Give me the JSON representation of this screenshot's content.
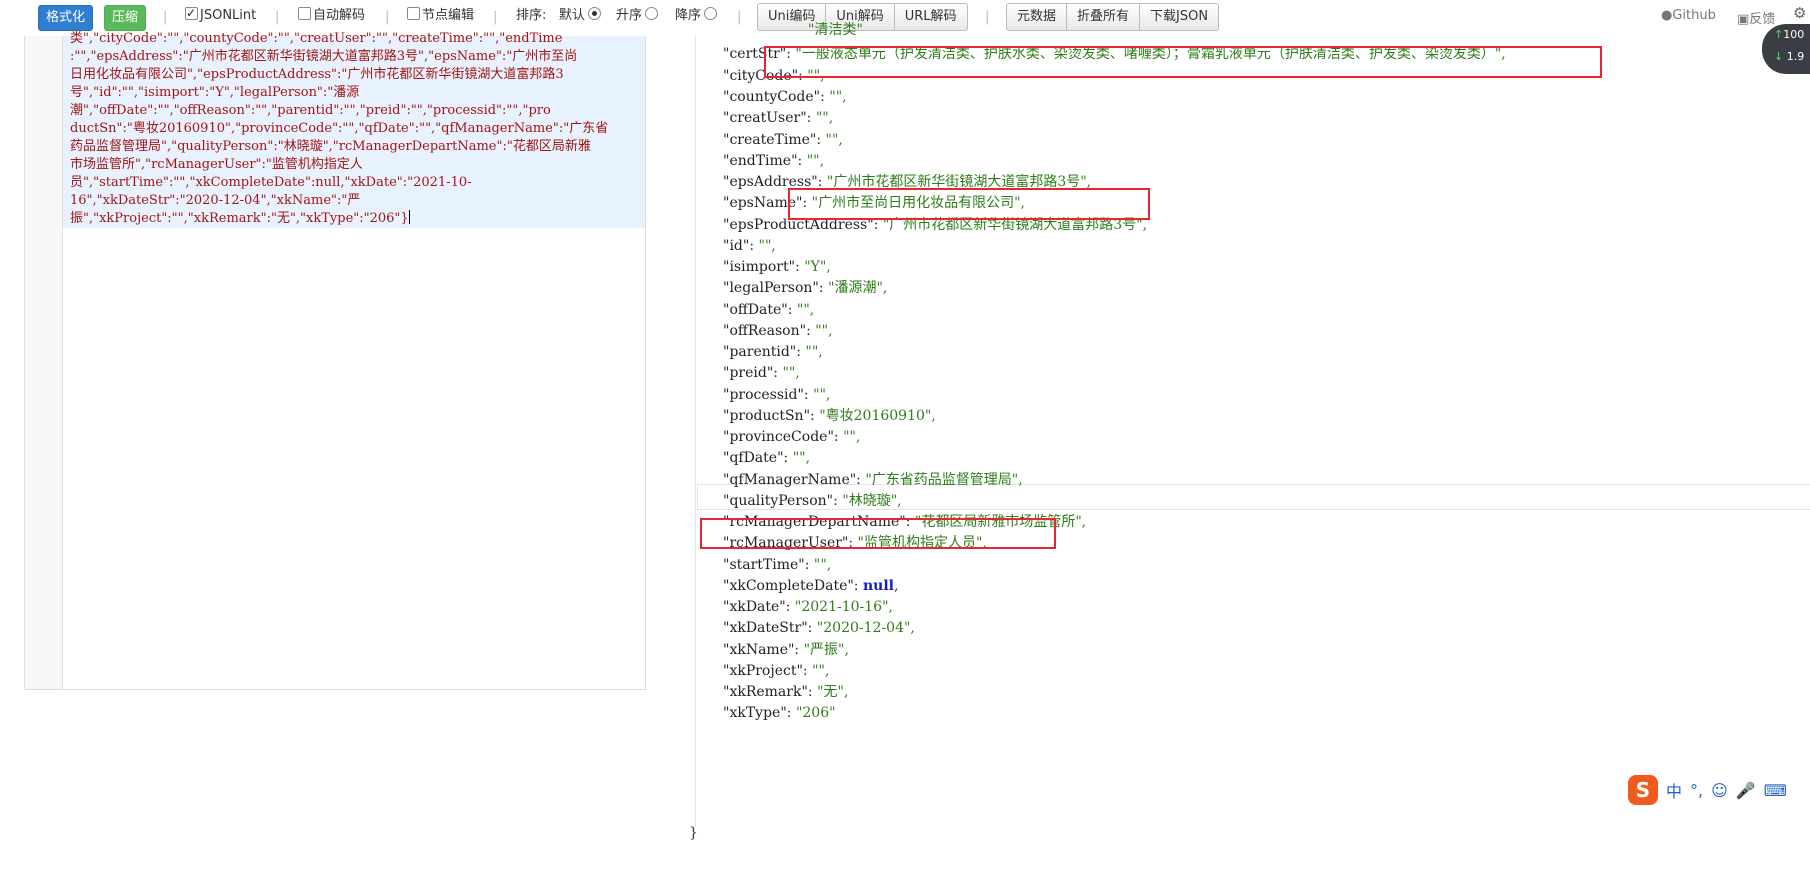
{
  "toolbar": {
    "format_label": "格式化",
    "compress_label": "压缩",
    "jsonlint_label": "JSONLint",
    "auto_decode_label": "自动解码",
    "node_edit_label": "节点编辑",
    "sort_label": "排序:",
    "sort_default": "默认",
    "sort_asc": "升序",
    "sort_desc": "降序",
    "uni_encode": "Uni编码",
    "uni_decode": "Uni解码",
    "url_decode": "URL解码",
    "meta_data": "元数据",
    "fold_all": "折叠所有",
    "download_json": "下载JSON",
    "github_label": "Github",
    "feedback_label": "反馈"
  },
  "speed": {
    "up": "100",
    "down": "1.9"
  },
  "raw_lines": [
    "类\",\"cityCode\":\"\",\"countyCode\":\"\",\"creatUser\":\"\",\"createTime\":\"\",\"endTime",
    ":\"\",\"epsAddress\":\"广州市花都区新华街镜湖大道富邦路3号\",\"epsName\":\"广州市至尚",
    "日用化妆品有限公司\",\"epsProductAddress\":\"广州市花都区新华街镜湖大道富邦路3",
    "号\",\"id\":\"\",\"isimport\":\"Y\",\"legalPerson\":\"潘源",
    "潮\",\"offDate\":\"\",\"offReason\":\"\",\"parentid\":\"\",\"preid\":\"\",\"processid\":\"\",\"pro",
    "ductSn\":\"粤妆20160910\",\"provinceCode\":\"\",\"qfDate\":\"\",\"qfManagerName\":\"广东省",
    "药品监督管理局\",\"qualityPerson\":\"林晓璇\",\"rcManagerDepartName\":\"花都区局新雅",
    "市场监管所\",\"rcManagerUser\":\"监管机构指定人",
    "员\",\"startTime\":\"\",\"xkCompleteDate\":null,\"xkDate\":\"2021-10-",
    "16\",\"xkDateStr\":\"2020-12-04\",\"xkName\":\"严",
    "振\",\"xkProject\":\"\",\"xkRemark\":\"无\",\"xkType\":\"206\"}"
  ],
  "json_lines": [
    {
      "key": "",
      "value": "\"清洁类\"",
      "partial": true
    },
    {
      "key": "\"certStr\"",
      "value": "\"一般液态单元（护发清洁类、护肤水类、染烫发类、啫喱类）；膏霜乳液单元（护肤清洁类、护发类、染烫发类）\","
    },
    {
      "key": "\"cityCode\"",
      "value": "\"\","
    },
    {
      "key": "\"countyCode\"",
      "value": "\"\","
    },
    {
      "key": "\"creatUser\"",
      "value": "\"\","
    },
    {
      "key": "\"createTime\"",
      "value": "\"\","
    },
    {
      "key": "\"endTime\"",
      "value": "\"\","
    },
    {
      "key": "\"epsAddress\"",
      "value": "\"广州市花都区新华街镜湖大道富邦路3号\","
    },
    {
      "key": "\"epsName\"",
      "value": "\"广州市至尚日用化妆品有限公司\","
    },
    {
      "key": "\"epsProductAddress\"",
      "value": "\"广州市花都区新华街镜湖大道富邦路3号\","
    },
    {
      "key": "\"id\"",
      "value": "\"\","
    },
    {
      "key": "\"isimport\"",
      "value": "\"Y\","
    },
    {
      "key": "\"legalPerson\"",
      "value": "\"潘源潮\","
    },
    {
      "key": "\"offDate\"",
      "value": "\"\","
    },
    {
      "key": "\"offReason\"",
      "value": "\"\","
    },
    {
      "key": "\"parentid\"",
      "value": "\"\","
    },
    {
      "key": "\"preid\"",
      "value": "\"\","
    },
    {
      "key": "\"processid\"",
      "value": "\"\","
    },
    {
      "key": "\"productSn\"",
      "value": "\"粤妆20160910\","
    },
    {
      "key": "\"provinceCode\"",
      "value": "\"\","
    },
    {
      "key": "\"qfDate\"",
      "value": "\"\","
    },
    {
      "key": "\"qfManagerName\"",
      "value": "\"广东省药品监督管理局\","
    },
    {
      "key": "\"qualityPerson\"",
      "value": "\"林晓璇\","
    },
    {
      "key": "\"rcManagerDepartName\"",
      "value": "\"花都区局新雅市场监管所\","
    },
    {
      "key": "\"rcManagerUser\"",
      "value": "\"监管机构指定人员\","
    },
    {
      "key": "\"startTime\"",
      "value": "\"\","
    },
    {
      "key": "\"xkCompleteDate\"",
      "value": "null",
      "null": true
    },
    {
      "key": "\"xkDate\"",
      "value": "\"2021-10-16\","
    },
    {
      "key": "\"xkDateStr\"",
      "value": "\"2020-12-04\","
    },
    {
      "key": "\"xkName\"",
      "value": "\"严振\","
    },
    {
      "key": "\"xkProject\"",
      "value": "\"\","
    },
    {
      "key": "\"xkRemark\"",
      "value": "\"无\","
    },
    {
      "key": "\"xkType\"",
      "value": "\"206\""
    }
  ],
  "closing_brace": "}",
  "ime": {
    "logo": "S",
    "lang": "中",
    "punct": "°,",
    "face": "☺",
    "mic": "🎤",
    "kbd": "⌨"
  },
  "colors": {
    "highlight_box": "#e8262f",
    "key": "#222222",
    "string": "#2e7d1a",
    "null": "#1a1ac8",
    "raw": "#a31515"
  }
}
